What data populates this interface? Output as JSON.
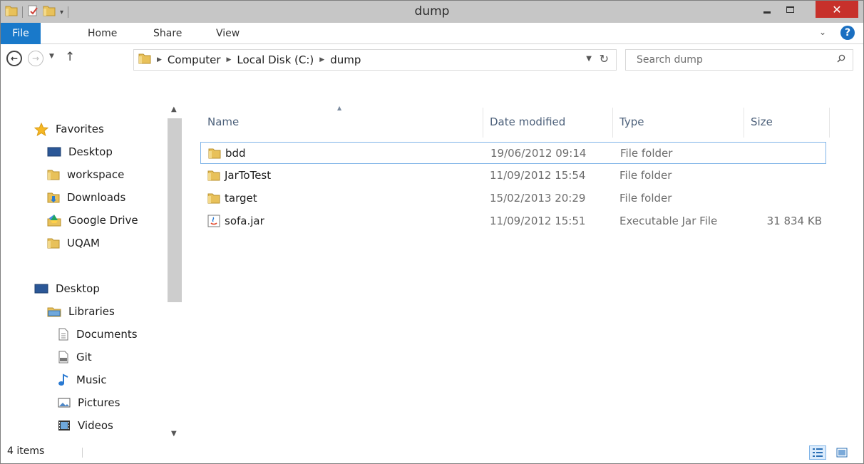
{
  "window": {
    "title": "dump"
  },
  "ribbon": {
    "tabs": [
      {
        "label": "File"
      },
      {
        "label": "Home"
      },
      {
        "label": "Share"
      },
      {
        "label": "View"
      }
    ]
  },
  "address": {
    "breadcrumbs": [
      "Computer",
      "Local Disk (C:)",
      "dump"
    ]
  },
  "search": {
    "placeholder": "Search dump"
  },
  "nav": {
    "favorites_label": "Favorites",
    "favorites": [
      "Desktop",
      "workspace",
      "Downloads",
      "Google Drive",
      "UQAM"
    ],
    "desktop_label": "Desktop",
    "libraries_label": "Libraries",
    "libraries": [
      "Documents",
      "Git",
      "Music",
      "Pictures",
      "Videos"
    ]
  },
  "columns": {
    "name": "Name",
    "date": "Date modified",
    "type": "Type",
    "size": "Size"
  },
  "files": [
    {
      "name": "bdd",
      "date": "19/06/2012 09:14",
      "type": "File folder",
      "size": "",
      "icon": "folder-icon",
      "selected": true
    },
    {
      "name": "JarToTest",
      "date": "11/09/2012 15:54",
      "type": "File folder",
      "size": "",
      "icon": "folder-icon",
      "selected": false
    },
    {
      "name": "target",
      "date": "15/02/2013 20:29",
      "type": "File folder",
      "size": "",
      "icon": "folder-icon",
      "selected": false
    },
    {
      "name": "sofa.jar",
      "date": "11/09/2012 15:51",
      "type": "Executable Jar File",
      "size": "31 834 KB",
      "icon": "jar-file-icon",
      "selected": false
    }
  ],
  "status": {
    "items_count": "4 items"
  },
  "colors": {
    "accent": "#1979ca",
    "close": "#c7312b",
    "selection_border": "#7fb4e8",
    "folder": "#e8c15a"
  }
}
